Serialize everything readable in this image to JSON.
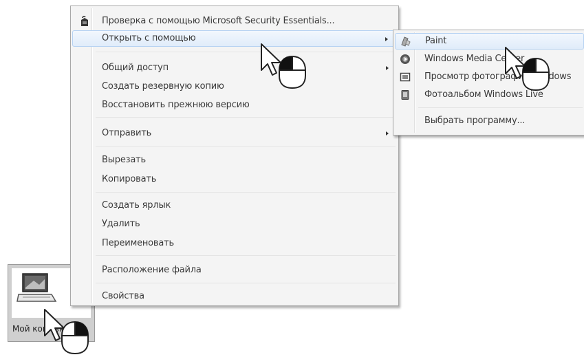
{
  "context_menu": {
    "items": [
      {
        "label": "Проверка с помощью Microsoft Security Essentials...",
        "icon": "security-essentials-icon"
      },
      {
        "label": "Открыть с помощью",
        "has_submenu": true,
        "highlighted": true
      },
      {
        "label": "Общий доступ",
        "has_submenu": true
      },
      {
        "label": "Создать резервную копию"
      },
      {
        "label": "Восстановить прежнюю версию"
      },
      {
        "label": "Отправить",
        "has_submenu": true
      },
      {
        "label": "Вырезать"
      },
      {
        "label": "Копировать"
      },
      {
        "label": "Создать ярлык"
      },
      {
        "label": "Удалить"
      },
      {
        "label": "Переименовать"
      },
      {
        "label": "Расположение файла"
      },
      {
        "label": "Свойства"
      }
    ]
  },
  "open_with_submenu": {
    "items": [
      {
        "label": "Paint",
        "icon": "paint-icon",
        "highlighted": true
      },
      {
        "label": "Windows Media Center",
        "icon": "media-center-icon"
      },
      {
        "label": "Просмотр фотографий Windows",
        "icon": "photo-viewer-icon"
      },
      {
        "label": "Фотоальбом Windows Live",
        "icon": "photo-gallery-icon"
      },
      {
        "label": "Выбрать программу..."
      }
    ]
  },
  "desktop_icon": {
    "caption": "Мой компьютер",
    "icon": "laptop-icon"
  },
  "colors": {
    "menu_bg": "#f4f4f4",
    "highlight": "#e0ecfa",
    "text": "#3a3a3a"
  }
}
